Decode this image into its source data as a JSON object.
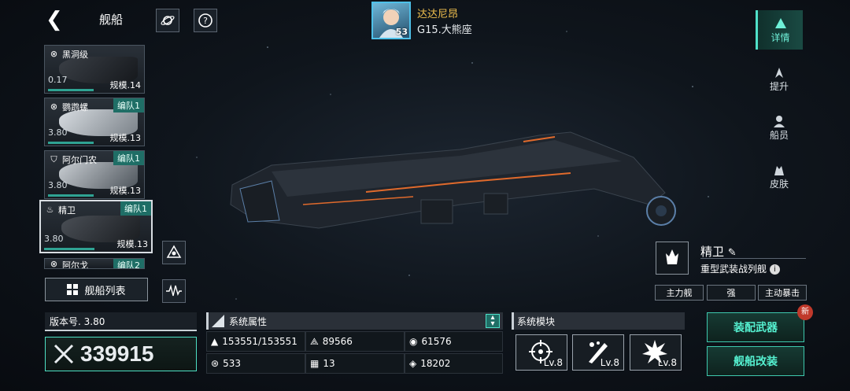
{
  "header": {
    "title": "舰船",
    "back_icon": "back-arrow-icon",
    "planet_icon": "planet-icon",
    "help_icon": "help-icon"
  },
  "player": {
    "name": "达达尼昂",
    "level": "53",
    "rank": "G15.大熊座"
  },
  "ship_list": [
    {
      "name": "黑洞级",
      "tag": "",
      "value": "0.17",
      "scale": "规模.14",
      "icon": "target-icon"
    },
    {
      "name": "鹦鹉螺",
      "tag": "编队1",
      "value": "3.80",
      "scale": "规模.13",
      "icon": "target-icon"
    },
    {
      "name": "阿尔门农",
      "tag": "编队1",
      "value": "3.80",
      "scale": "规模.13",
      "icon": "shield-icon"
    },
    {
      "name": "精卫",
      "tag": "编队1",
      "value": "3.80",
      "scale": "规模.13",
      "icon": "flame-icon"
    },
    {
      "name": "阿尔戈",
      "tag": "编队2",
      "value": "",
      "scale": "",
      "icon": "target-icon"
    }
  ],
  "list_button": "舰船列表",
  "ship": {
    "name": "精卫",
    "type": "重型武装战列舰",
    "tags": [
      "主力舰",
      "强",
      "主动暴击"
    ]
  },
  "right_nav": [
    {
      "label": "详情",
      "icon": "detail-icon"
    },
    {
      "label": "提升",
      "icon": "upgrade-icon"
    },
    {
      "label": "船员",
      "icon": "crew-icon"
    },
    {
      "label": "皮肤",
      "icon": "skin-icon"
    }
  ],
  "version": "版本号. 3.80",
  "power": "339915",
  "attrs": {
    "title": "系统属性",
    "values": [
      "153551/153551",
      "89566",
      "61576",
      "533",
      "13",
      "18202"
    ]
  },
  "modules": {
    "title": "系统模块",
    "items": [
      {
        "level": "Lv.8",
        "icon": "crosshair-icon"
      },
      {
        "level": "Lv.8",
        "icon": "missile-icon"
      },
      {
        "level": "Lv.8",
        "icon": "explosion-icon"
      }
    ]
  },
  "actions": {
    "equip": "装配武器",
    "modify": "舰船改装",
    "new_badge": "新"
  },
  "colors": {
    "accent": "#4fe0c8",
    "gold": "#f2c14e",
    "panel": "#1a2027"
  }
}
